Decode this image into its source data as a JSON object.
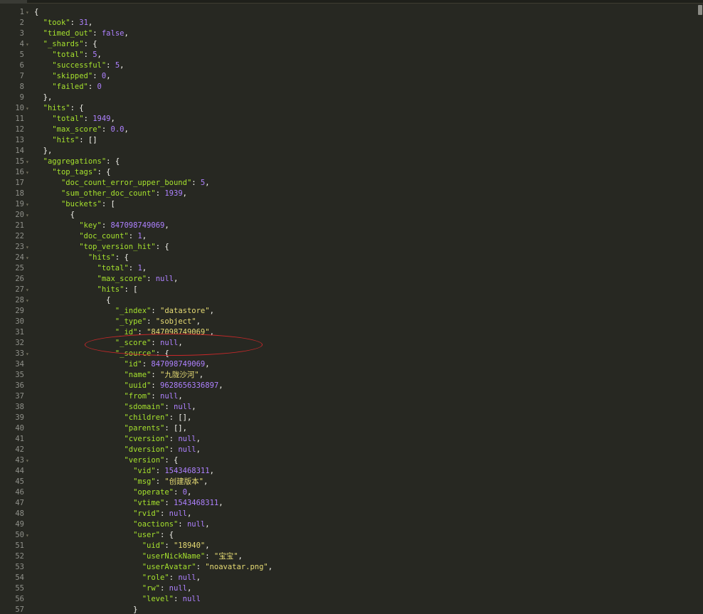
{
  "editor": {
    "colors": {
      "background": "#272822",
      "key": "#a6e22e",
      "string": "#e6db74",
      "number": "#ae81ff",
      "punctuation": "#f8f8f2",
      "gutter": "#8f908a",
      "annotation": "#c8282a"
    },
    "annotation_note": "red ellipse highlighting the _score line",
    "lines": [
      {
        "num": "1",
        "fold": true,
        "indent": 0,
        "tokens": [
          {
            "t": "p",
            "v": "{"
          }
        ]
      },
      {
        "num": "2",
        "fold": false,
        "indent": 1,
        "tokens": [
          {
            "t": "k",
            "v": "\"took\""
          },
          {
            "t": "p",
            "v": ": "
          },
          {
            "t": "n",
            "v": "31"
          },
          {
            "t": "p",
            "v": ","
          }
        ]
      },
      {
        "num": "3",
        "fold": false,
        "indent": 1,
        "tokens": [
          {
            "t": "k",
            "v": "\"timed_out\""
          },
          {
            "t": "p",
            "v": ": "
          },
          {
            "t": "n",
            "v": "false"
          },
          {
            "t": "p",
            "v": ","
          }
        ]
      },
      {
        "num": "4",
        "fold": true,
        "indent": 1,
        "tokens": [
          {
            "t": "k",
            "v": "\"_shards\""
          },
          {
            "t": "p",
            "v": ": {"
          }
        ]
      },
      {
        "num": "5",
        "fold": false,
        "indent": 2,
        "tokens": [
          {
            "t": "k",
            "v": "\"total\""
          },
          {
            "t": "p",
            "v": ": "
          },
          {
            "t": "n",
            "v": "5"
          },
          {
            "t": "p",
            "v": ","
          }
        ]
      },
      {
        "num": "6",
        "fold": false,
        "indent": 2,
        "tokens": [
          {
            "t": "k",
            "v": "\"successful\""
          },
          {
            "t": "p",
            "v": ": "
          },
          {
            "t": "n",
            "v": "5"
          },
          {
            "t": "p",
            "v": ","
          }
        ]
      },
      {
        "num": "7",
        "fold": false,
        "indent": 2,
        "tokens": [
          {
            "t": "k",
            "v": "\"skipped\""
          },
          {
            "t": "p",
            "v": ": "
          },
          {
            "t": "n",
            "v": "0"
          },
          {
            "t": "p",
            "v": ","
          }
        ]
      },
      {
        "num": "8",
        "fold": false,
        "indent": 2,
        "tokens": [
          {
            "t": "k",
            "v": "\"failed\""
          },
          {
            "t": "p",
            "v": ": "
          },
          {
            "t": "n",
            "v": "0"
          }
        ]
      },
      {
        "num": "9",
        "fold": false,
        "indent": 1,
        "tokens": [
          {
            "t": "p",
            "v": "},"
          }
        ]
      },
      {
        "num": "10",
        "fold": true,
        "indent": 1,
        "tokens": [
          {
            "t": "k",
            "v": "\"hits\""
          },
          {
            "t": "p",
            "v": ": {"
          }
        ]
      },
      {
        "num": "11",
        "fold": false,
        "indent": 2,
        "tokens": [
          {
            "t": "k",
            "v": "\"total\""
          },
          {
            "t": "p",
            "v": ": "
          },
          {
            "t": "n",
            "v": "1949"
          },
          {
            "t": "p",
            "v": ","
          }
        ]
      },
      {
        "num": "12",
        "fold": false,
        "indent": 2,
        "tokens": [
          {
            "t": "k",
            "v": "\"max_score\""
          },
          {
            "t": "p",
            "v": ": "
          },
          {
            "t": "n",
            "v": "0.0"
          },
          {
            "t": "p",
            "v": ","
          }
        ]
      },
      {
        "num": "13",
        "fold": false,
        "indent": 2,
        "tokens": [
          {
            "t": "k",
            "v": "\"hits\""
          },
          {
            "t": "p",
            "v": ": []"
          }
        ]
      },
      {
        "num": "14",
        "fold": false,
        "indent": 1,
        "tokens": [
          {
            "t": "p",
            "v": "},"
          }
        ]
      },
      {
        "num": "15",
        "fold": true,
        "indent": 1,
        "tokens": [
          {
            "t": "k",
            "v": "\"aggregations\""
          },
          {
            "t": "p",
            "v": ": {"
          }
        ]
      },
      {
        "num": "16",
        "fold": true,
        "indent": 2,
        "tokens": [
          {
            "t": "k",
            "v": "\"top_tags\""
          },
          {
            "t": "p",
            "v": ": {"
          }
        ]
      },
      {
        "num": "17",
        "fold": false,
        "indent": 3,
        "tokens": [
          {
            "t": "k",
            "v": "\"doc_count_error_upper_bound\""
          },
          {
            "t": "p",
            "v": ": "
          },
          {
            "t": "n",
            "v": "5"
          },
          {
            "t": "p",
            "v": ","
          }
        ]
      },
      {
        "num": "18",
        "fold": false,
        "indent": 3,
        "tokens": [
          {
            "t": "k",
            "v": "\"sum_other_doc_count\""
          },
          {
            "t": "p",
            "v": ": "
          },
          {
            "t": "n",
            "v": "1939"
          },
          {
            "t": "p",
            "v": ","
          }
        ]
      },
      {
        "num": "19",
        "fold": true,
        "indent": 3,
        "tokens": [
          {
            "t": "k",
            "v": "\"buckets\""
          },
          {
            "t": "p",
            "v": ": ["
          }
        ]
      },
      {
        "num": "20",
        "fold": true,
        "indent": 4,
        "tokens": [
          {
            "t": "p",
            "v": "{"
          }
        ]
      },
      {
        "num": "21",
        "fold": false,
        "indent": 5,
        "tokens": [
          {
            "t": "k",
            "v": "\"key\""
          },
          {
            "t": "p",
            "v": ": "
          },
          {
            "t": "n",
            "v": "847098749069"
          },
          {
            "t": "p",
            "v": ","
          }
        ]
      },
      {
        "num": "22",
        "fold": false,
        "indent": 5,
        "tokens": [
          {
            "t": "k",
            "v": "\"doc_count\""
          },
          {
            "t": "p",
            "v": ": "
          },
          {
            "t": "n",
            "v": "1"
          },
          {
            "t": "p",
            "v": ","
          }
        ]
      },
      {
        "num": "23",
        "fold": true,
        "indent": 5,
        "tokens": [
          {
            "t": "k",
            "v": "\"top_version_hit\""
          },
          {
            "t": "p",
            "v": ": {"
          }
        ]
      },
      {
        "num": "24",
        "fold": true,
        "indent": 6,
        "tokens": [
          {
            "t": "k",
            "v": "\"hits\""
          },
          {
            "t": "p",
            "v": ": {"
          }
        ]
      },
      {
        "num": "25",
        "fold": false,
        "indent": 7,
        "tokens": [
          {
            "t": "k",
            "v": "\"total\""
          },
          {
            "t": "p",
            "v": ": "
          },
          {
            "t": "n",
            "v": "1"
          },
          {
            "t": "p",
            "v": ","
          }
        ]
      },
      {
        "num": "26",
        "fold": false,
        "indent": 7,
        "tokens": [
          {
            "t": "k",
            "v": "\"max_score\""
          },
          {
            "t": "p",
            "v": ": "
          },
          {
            "t": "n",
            "v": "null"
          },
          {
            "t": "p",
            "v": ","
          }
        ]
      },
      {
        "num": "27",
        "fold": true,
        "indent": 7,
        "tokens": [
          {
            "t": "k",
            "v": "\"hits\""
          },
          {
            "t": "p",
            "v": ": ["
          }
        ]
      },
      {
        "num": "28",
        "fold": true,
        "indent": 8,
        "tokens": [
          {
            "t": "p",
            "v": "{"
          }
        ]
      },
      {
        "num": "29",
        "fold": false,
        "indent": 9,
        "tokens": [
          {
            "t": "k",
            "v": "\"_index\""
          },
          {
            "t": "p",
            "v": ": "
          },
          {
            "t": "s",
            "v": "\"datastore\""
          },
          {
            "t": "p",
            "v": ","
          }
        ]
      },
      {
        "num": "30",
        "fold": false,
        "indent": 9,
        "tokens": [
          {
            "t": "k",
            "v": "\"_type\""
          },
          {
            "t": "p",
            "v": ": "
          },
          {
            "t": "s",
            "v": "\"sobject\""
          },
          {
            "t": "p",
            "v": ","
          }
        ]
      },
      {
        "num": "31",
        "fold": false,
        "indent": 9,
        "tokens": [
          {
            "t": "k",
            "v": "\"_id\""
          },
          {
            "t": "p",
            "v": ": "
          },
          {
            "t": "s",
            "v": "\"847098749069\""
          },
          {
            "t": "p",
            "v": ","
          }
        ]
      },
      {
        "num": "32",
        "fold": false,
        "indent": 9,
        "tokens": [
          {
            "t": "k",
            "v": "\"_score\""
          },
          {
            "t": "p",
            "v": ": "
          },
          {
            "t": "n",
            "v": "null"
          },
          {
            "t": "p",
            "v": ","
          }
        ]
      },
      {
        "num": "33",
        "fold": true,
        "indent": 9,
        "tokens": [
          {
            "t": "k",
            "v": "\"_source\""
          },
          {
            "t": "p",
            "v": ": {"
          }
        ]
      },
      {
        "num": "34",
        "fold": false,
        "indent": 10,
        "tokens": [
          {
            "t": "k",
            "v": "\"id\""
          },
          {
            "t": "p",
            "v": ": "
          },
          {
            "t": "n",
            "v": "847098749069"
          },
          {
            "t": "p",
            "v": ","
          }
        ]
      },
      {
        "num": "35",
        "fold": false,
        "indent": 10,
        "tokens": [
          {
            "t": "k",
            "v": "\"name\""
          },
          {
            "t": "p",
            "v": ": "
          },
          {
            "t": "s",
            "v": "\"九陇沙河\""
          },
          {
            "t": "p",
            "v": ","
          }
        ]
      },
      {
        "num": "36",
        "fold": false,
        "indent": 10,
        "tokens": [
          {
            "t": "k",
            "v": "\"uuid\""
          },
          {
            "t": "p",
            "v": ": "
          },
          {
            "t": "n",
            "v": "9628656336897"
          },
          {
            "t": "p",
            "v": ","
          }
        ]
      },
      {
        "num": "37",
        "fold": false,
        "indent": 10,
        "tokens": [
          {
            "t": "k",
            "v": "\"from\""
          },
          {
            "t": "p",
            "v": ": "
          },
          {
            "t": "n",
            "v": "null"
          },
          {
            "t": "p",
            "v": ","
          }
        ]
      },
      {
        "num": "38",
        "fold": false,
        "indent": 10,
        "tokens": [
          {
            "t": "k",
            "v": "\"sdomain\""
          },
          {
            "t": "p",
            "v": ": "
          },
          {
            "t": "n",
            "v": "null"
          },
          {
            "t": "p",
            "v": ","
          }
        ]
      },
      {
        "num": "39",
        "fold": false,
        "indent": 10,
        "tokens": [
          {
            "t": "k",
            "v": "\"children\""
          },
          {
            "t": "p",
            "v": ": [],"
          }
        ]
      },
      {
        "num": "40",
        "fold": false,
        "indent": 10,
        "tokens": [
          {
            "t": "k",
            "v": "\"parents\""
          },
          {
            "t": "p",
            "v": ": [],"
          }
        ]
      },
      {
        "num": "41",
        "fold": false,
        "indent": 10,
        "tokens": [
          {
            "t": "k",
            "v": "\"cversion\""
          },
          {
            "t": "p",
            "v": ": "
          },
          {
            "t": "n",
            "v": "null"
          },
          {
            "t": "p",
            "v": ","
          }
        ]
      },
      {
        "num": "42",
        "fold": false,
        "indent": 10,
        "tokens": [
          {
            "t": "k",
            "v": "\"dversion\""
          },
          {
            "t": "p",
            "v": ": "
          },
          {
            "t": "n",
            "v": "null"
          },
          {
            "t": "p",
            "v": ","
          }
        ]
      },
      {
        "num": "43",
        "fold": true,
        "indent": 10,
        "tokens": [
          {
            "t": "k",
            "v": "\"version\""
          },
          {
            "t": "p",
            "v": ": {"
          }
        ]
      },
      {
        "num": "44",
        "fold": false,
        "indent": 11,
        "tokens": [
          {
            "t": "k",
            "v": "\"vid\""
          },
          {
            "t": "p",
            "v": ": "
          },
          {
            "t": "n",
            "v": "1543468311"
          },
          {
            "t": "p",
            "v": ","
          }
        ]
      },
      {
        "num": "45",
        "fold": false,
        "indent": 11,
        "tokens": [
          {
            "t": "k",
            "v": "\"msg\""
          },
          {
            "t": "p",
            "v": ": "
          },
          {
            "t": "s",
            "v": "\"创建版本\""
          },
          {
            "t": "p",
            "v": ","
          }
        ]
      },
      {
        "num": "46",
        "fold": false,
        "indent": 11,
        "tokens": [
          {
            "t": "k",
            "v": "\"operate\""
          },
          {
            "t": "p",
            "v": ": "
          },
          {
            "t": "n",
            "v": "0"
          },
          {
            "t": "p",
            "v": ","
          }
        ]
      },
      {
        "num": "47",
        "fold": false,
        "indent": 11,
        "tokens": [
          {
            "t": "k",
            "v": "\"vtime\""
          },
          {
            "t": "p",
            "v": ": "
          },
          {
            "t": "n",
            "v": "1543468311"
          },
          {
            "t": "p",
            "v": ","
          }
        ]
      },
      {
        "num": "48",
        "fold": false,
        "indent": 11,
        "tokens": [
          {
            "t": "k",
            "v": "\"rvid\""
          },
          {
            "t": "p",
            "v": ": "
          },
          {
            "t": "n",
            "v": "null"
          },
          {
            "t": "p",
            "v": ","
          }
        ]
      },
      {
        "num": "49",
        "fold": false,
        "indent": 11,
        "tokens": [
          {
            "t": "k",
            "v": "\"oactions\""
          },
          {
            "t": "p",
            "v": ": "
          },
          {
            "t": "n",
            "v": "null"
          },
          {
            "t": "p",
            "v": ","
          }
        ]
      },
      {
        "num": "50",
        "fold": true,
        "indent": 11,
        "tokens": [
          {
            "t": "k",
            "v": "\"user\""
          },
          {
            "t": "p",
            "v": ": {"
          }
        ]
      },
      {
        "num": "51",
        "fold": false,
        "indent": 12,
        "tokens": [
          {
            "t": "k",
            "v": "\"uid\""
          },
          {
            "t": "p",
            "v": ": "
          },
          {
            "t": "s",
            "v": "\"18940\""
          },
          {
            "t": "p",
            "v": ","
          }
        ]
      },
      {
        "num": "52",
        "fold": false,
        "indent": 12,
        "tokens": [
          {
            "t": "k",
            "v": "\"userNickName\""
          },
          {
            "t": "p",
            "v": ": "
          },
          {
            "t": "s",
            "v": "\"宝宝\""
          },
          {
            "t": "p",
            "v": ","
          }
        ]
      },
      {
        "num": "53",
        "fold": false,
        "indent": 12,
        "tokens": [
          {
            "t": "k",
            "v": "\"userAvatar\""
          },
          {
            "t": "p",
            "v": ": "
          },
          {
            "t": "s",
            "v": "\"noavatar.png\""
          },
          {
            "t": "p",
            "v": ","
          }
        ]
      },
      {
        "num": "54",
        "fold": false,
        "indent": 12,
        "tokens": [
          {
            "t": "k",
            "v": "\"role\""
          },
          {
            "t": "p",
            "v": ": "
          },
          {
            "t": "n",
            "v": "null"
          },
          {
            "t": "p",
            "v": ","
          }
        ]
      },
      {
        "num": "55",
        "fold": false,
        "indent": 12,
        "tokens": [
          {
            "t": "k",
            "v": "\"rw\""
          },
          {
            "t": "p",
            "v": ": "
          },
          {
            "t": "n",
            "v": "null"
          },
          {
            "t": "p",
            "v": ","
          }
        ]
      },
      {
        "num": "56",
        "fold": false,
        "indent": 12,
        "tokens": [
          {
            "t": "k",
            "v": "\"level\""
          },
          {
            "t": "p",
            "v": ": "
          },
          {
            "t": "n",
            "v": "null"
          }
        ]
      },
      {
        "num": "57",
        "fold": false,
        "indent": 11,
        "tokens": [
          {
            "t": "p",
            "v": "}"
          }
        ]
      }
    ]
  }
}
